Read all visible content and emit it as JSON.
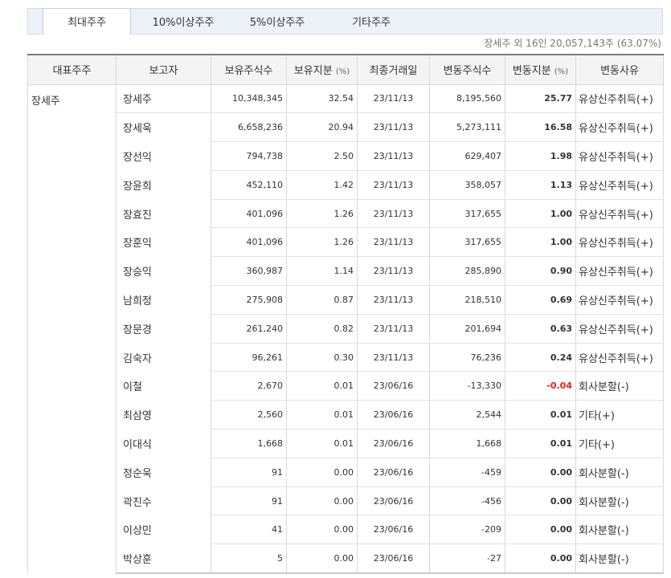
{
  "tabs": [
    "최대주주",
    "10%이상주주",
    "5%이상주주",
    "기타주주"
  ],
  "active_tab": 0,
  "summary": "장세주 외 16인 20,057,143주 (63.07%)",
  "columns": [
    "대표주주",
    "보고자",
    "보유주식수",
    "보유지분",
    "최종거래일",
    "변동주식수",
    "변동지분",
    "변동사유"
  ],
  "unit": "(%)",
  "representative": "장세주",
  "rows": [
    {
      "name": "장세주",
      "shares": "10,348,345",
      "ratio": "32.54",
      "date": "23/11/13",
      "chg": "8,195,560",
      "chg_ratio": "25.77",
      "reason": "유상신주취득(+)"
    },
    {
      "name": "장세욱",
      "shares": "6,658,236",
      "ratio": "20.94",
      "date": "23/11/13",
      "chg": "5,273,111",
      "chg_ratio": "16.58",
      "reason": "유상신주취득(+)"
    },
    {
      "name": "장선익",
      "shares": "794,738",
      "ratio": "2.50",
      "date": "23/11/13",
      "chg": "629,407",
      "chg_ratio": "1.98",
      "reason": "유상신주취득(+)"
    },
    {
      "name": "장윤희",
      "shares": "452,110",
      "ratio": "1.42",
      "date": "23/11/13",
      "chg": "358,057",
      "chg_ratio": "1.13",
      "reason": "유상신주취득(+)"
    },
    {
      "name": "장효진",
      "shares": "401,096",
      "ratio": "1.26",
      "date": "23/11/13",
      "chg": "317,655",
      "chg_ratio": "1.00",
      "reason": "유상신주취득(+)"
    },
    {
      "name": "장훈익",
      "shares": "401,096",
      "ratio": "1.26",
      "date": "23/11/13",
      "chg": "317,655",
      "chg_ratio": "1.00",
      "reason": "유상신주취득(+)"
    },
    {
      "name": "장승익",
      "shares": "360,987",
      "ratio": "1.14",
      "date": "23/11/13",
      "chg": "285,890",
      "chg_ratio": "0.90",
      "reason": "유상신주취득(+)"
    },
    {
      "name": "남희정",
      "shares": "275,908",
      "ratio": "0.87",
      "date": "23/11/13",
      "chg": "218,510",
      "chg_ratio": "0.69",
      "reason": "유상신주취득(+)"
    },
    {
      "name": "장문경",
      "shares": "261,240",
      "ratio": "0.82",
      "date": "23/11/13",
      "chg": "201,694",
      "chg_ratio": "0.63",
      "reason": "유상신주취득(+)"
    },
    {
      "name": "김숙자",
      "shares": "96,261",
      "ratio": "0.30",
      "date": "23/11/13",
      "chg": "76,236",
      "chg_ratio": "0.24",
      "reason": "유상신주취득(+)"
    },
    {
      "name": "이철",
      "shares": "2,670",
      "ratio": "0.01",
      "date": "23/06/16",
      "chg": "-13,330",
      "chg_ratio": "-0.04",
      "reason": "회사분할(-)"
    },
    {
      "name": "최삼영",
      "shares": "2,560",
      "ratio": "0.01",
      "date": "23/06/16",
      "chg": "2,544",
      "chg_ratio": "0.01",
      "reason": "기타(+)"
    },
    {
      "name": "이대식",
      "shares": "1,668",
      "ratio": "0.01",
      "date": "23/06/16",
      "chg": "1,668",
      "chg_ratio": "0.01",
      "reason": "기타(+)"
    },
    {
      "name": "정순욱",
      "shares": "91",
      "ratio": "0.00",
      "date": "23/06/16",
      "chg": "-459",
      "chg_ratio": "0.00",
      "reason": "회사분할(-)"
    },
    {
      "name": "곽진수",
      "shares": "91",
      "ratio": "0.00",
      "date": "23/06/16",
      "chg": "-456",
      "chg_ratio": "0.00",
      "reason": "회사분할(-)"
    },
    {
      "name": "이상민",
      "shares": "41",
      "ratio": "0.00",
      "date": "23/06/16",
      "chg": "-209",
      "chg_ratio": "0.00",
      "reason": "회사분할(-)"
    },
    {
      "name": "박상훈",
      "shares": "5",
      "ratio": "0.00",
      "date": "23/06/16",
      "chg": "-27",
      "chg_ratio": "0.00",
      "reason": "회사분할(-)"
    }
  ],
  "colors": {
    "negative": "#e02020",
    "tab_bg": "#edf1f8",
    "header_bg": "#f4f4f4"
  }
}
